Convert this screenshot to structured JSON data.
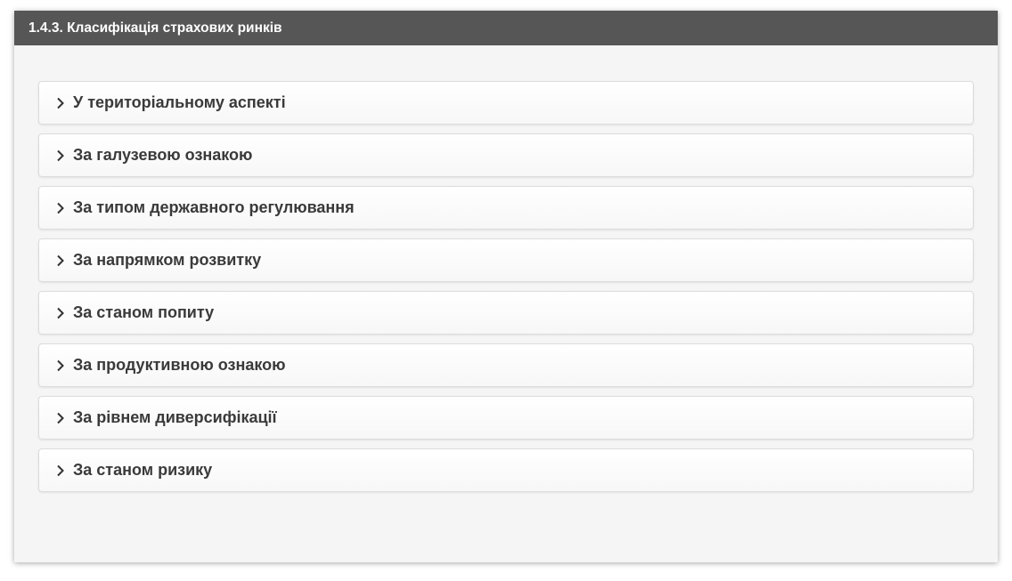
{
  "section": {
    "title": "1.4.3. Класифікація страхових ринків"
  },
  "accordion": {
    "items": [
      {
        "label": "У територіальному аспекті",
        "icon": "chevron-right-icon"
      },
      {
        "label": "За галузевою ознакою",
        "icon": "chevron-right-icon"
      },
      {
        "label": "За типом державного регулювання",
        "icon": "chevron-right-icon"
      },
      {
        "label": "За напрямком розвитку",
        "icon": "chevron-right-icon"
      },
      {
        "label": "За станом попиту",
        "icon": "chevron-right-icon"
      },
      {
        "label": "За продуктивною ознакою",
        "icon": "chevron-right-icon"
      },
      {
        "label": "За рівнем диверсифікації",
        "icon": "chevron-right-icon"
      },
      {
        "label": "За станом ризику",
        "icon": "chevron-right-icon"
      }
    ]
  },
  "colors": {
    "header_bg": "#565656",
    "header_text": "#ffffff",
    "card_bg": "#f5f5f5",
    "item_text": "#3a3a3a"
  }
}
